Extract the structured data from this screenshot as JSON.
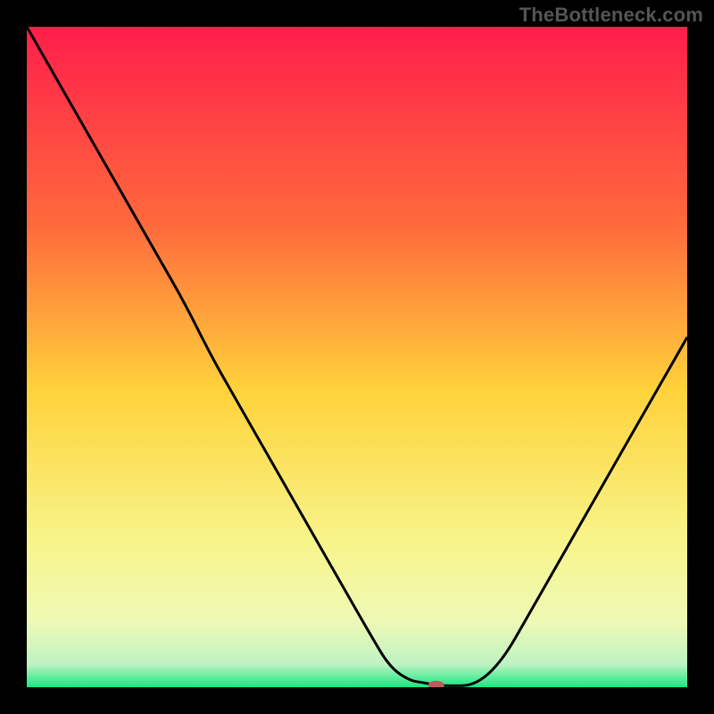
{
  "watermark": "TheBottleneck.com",
  "chart_data": {
    "type": "line",
    "title": "",
    "xlabel": "",
    "ylabel": "",
    "xlim": [
      0,
      100
    ],
    "ylim": [
      0,
      100
    ],
    "grid": false,
    "legend": false,
    "gradient_stops": [
      {
        "offset": 0,
        "color": "#ff1e4b"
      },
      {
        "offset": 0.3,
        "color": "#ff6a3c"
      },
      {
        "offset": 0.55,
        "color": "#ffd23a"
      },
      {
        "offset": 0.78,
        "color": "#f7f58a"
      },
      {
        "offset": 0.9,
        "color": "#eef9b5"
      },
      {
        "offset": 0.965,
        "color": "#bff3c3"
      },
      {
        "offset": 1.0,
        "color": "#17e880"
      }
    ],
    "series": [
      {
        "name": "bottleneck-curve",
        "stroke": "#000000",
        "x": [
          0,
          4,
          8,
          12,
          16,
          20,
          24,
          28,
          32,
          36,
          40,
          44,
          48,
          52,
          55,
          58,
          60,
          62,
          64,
          68,
          72,
          76,
          80,
          84,
          88,
          92,
          96,
          100
        ],
        "y": [
          100,
          93,
          86,
          79,
          72,
          65,
          58,
          50,
          43,
          36,
          29,
          22,
          15,
          8,
          3,
          1,
          0.7,
          0.3,
          0.2,
          0.3,
          4,
          11,
          18,
          25,
          32,
          39,
          46,
          53
        ]
      }
    ],
    "marker": {
      "name": "min-point",
      "x": 62,
      "y": 0.3,
      "color": "#c05a5a",
      "rx": 9,
      "ry": 5
    }
  }
}
